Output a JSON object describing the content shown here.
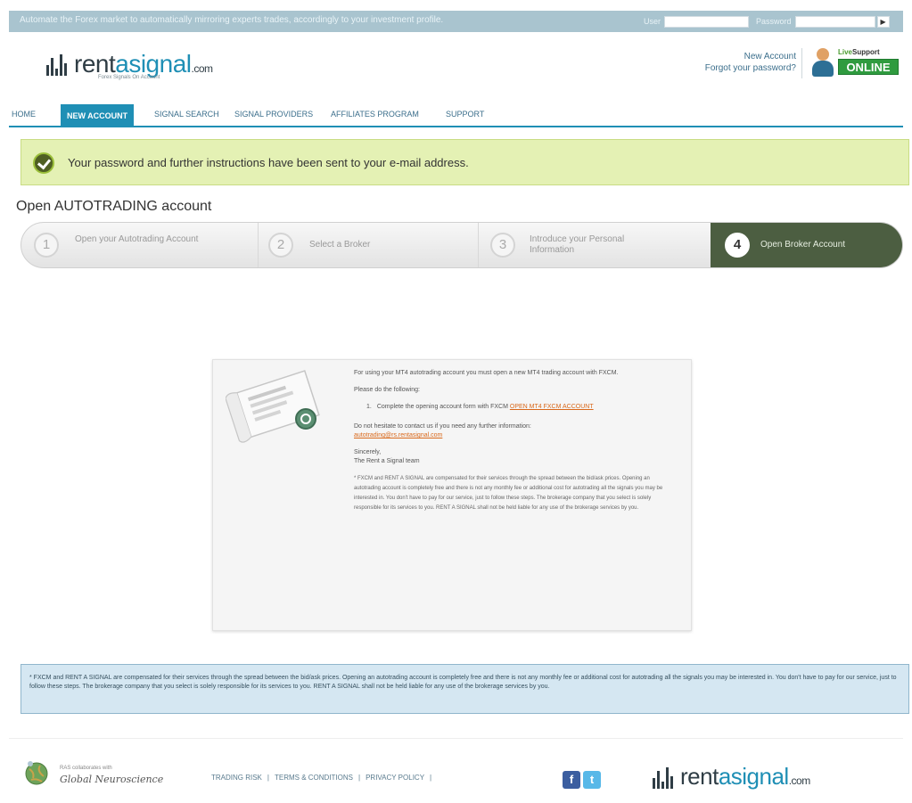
{
  "topbar": {
    "tagline": "Automate the Forex market to automatically mirroring experts trades, accordingly to your investment profile.",
    "user_label": "User",
    "password_label": "Password",
    "go_label": "▶"
  },
  "header": {
    "logo_main": "rent",
    "logo_accent": "asignal",
    "logo_suffix": ".com",
    "logo_tagline": "Forex Signals On Account",
    "new_account_link": "New Account",
    "forgot_password_link": "Forgot your password?",
    "live_support_label_a": "Live",
    "live_support_label_b": "Support",
    "online_label": "ONLINE"
  },
  "nav": {
    "items": [
      {
        "label": "HOME"
      },
      {
        "label": "NEW ACCOUNT",
        "active": true
      },
      {
        "label": "SIGNAL SEARCH"
      },
      {
        "label": "SIGNAL PROVIDERS"
      },
      {
        "label": "AFFILIATES PROGRAM"
      },
      {
        "label": "SUPPORT"
      }
    ]
  },
  "message": {
    "success": "Your password and further instructions have been sent to your e-mail address."
  },
  "page": {
    "title": "Open AUTOTRADING account"
  },
  "steps": [
    {
      "number": "1",
      "label": "Open your Autotrading Account"
    },
    {
      "number": "2",
      "label": "Select a Broker"
    },
    {
      "number": "3",
      "label": "Introduce your Personal Information"
    },
    {
      "number": "4",
      "label": "Open Broker Account",
      "active": true
    }
  ],
  "card": {
    "intro": "For using your MT4 autotrading account you must open a new MT4 trading account with FXCM.",
    "instructions_heading": "Please do the following:",
    "step_number": "1.",
    "step_text": "Complete the opening account form with FXCM",
    "step_link": "OPEN MT4 FXCM ACCOUNT",
    "contact_text": "Do not hesitate to contact us if you need any further information:",
    "contact_email": "autotrading@rs.rentasignal.com",
    "sign_off": "Sincerely,",
    "signature": "The Rent a Signal team",
    "disclaimer": "* FXCM and RENT A SIGNAL are compensated for their services through the spread between the bid/ask prices. Opening an autotrading account is completely free and there is not any monthly fee or additional cost for autotrading all the signals you may be interested in. You don't have to pay for our service, just to follow these steps. The brokerage company that you select is solely responsible for its services to you. RENT A SIGNAL shall not be held liable for any use of the brokerage services by you."
  },
  "notice": {
    "text": "* FXCM and RENT A SIGNAL are compensated for their services through the spread between the bid/ask prices. Opening an autotrading account is completely free and there is not any monthly fee or additional cost for autotrading all the signals you may be interested in. You don't have to pay for our service, just to follow these steps. The brokerage company that you select is solely responsible for its services to you. RENT A SIGNAL shall not be held liable for any use of the brokerage services by you."
  },
  "footer": {
    "partner_small": "RAS collaborates with",
    "partner_name": "Global Neuroscience",
    "links": [
      "TRADING RISK",
      "TERMS & CONDITIONS",
      "PRIVACY POLICY"
    ],
    "facebook_glyph": "f",
    "twitter_glyph": "t"
  },
  "colors": {
    "accent": "#1f8fb5",
    "success_bg": "#e4f1b4",
    "step_active": "#4c5e41",
    "link_orange": "#d9681a",
    "online_green": "#2f9b3f"
  },
  "icons": {
    "success": "check-circle-icon",
    "document": "document-certificate-icon",
    "globe": "globe-icon",
    "support": "support-agent-icon"
  }
}
